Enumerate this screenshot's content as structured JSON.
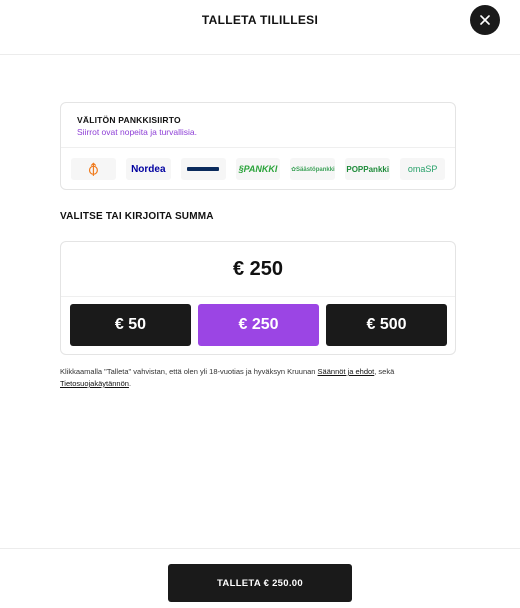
{
  "header": {
    "title": "TALLETA TILILLESI",
    "close_icon": "close-icon"
  },
  "bank_transfer": {
    "title": "VÄLITÖN PANKKISIIRTO",
    "subtitle": "Siirrot ovat nopeita ja turvallisia.",
    "banks": [
      {
        "name": "OP",
        "glyph": "⦽",
        "icon": "op-logo"
      },
      {
        "name": "Nordea",
        "icon": "nordea-logo"
      },
      {
        "name": "Danske Bank",
        "icon": "danske-bank-logo"
      },
      {
        "name": "S-PANKKI",
        "display": "PANKKI",
        "icon": "s-pankki-logo"
      },
      {
        "name": "Säästöpankki",
        "icon": "saastopankki-logo"
      },
      {
        "name": "POP Pankki",
        "display": "POPPankki",
        "icon": "pop-pankki-logo"
      },
      {
        "name": "OmaSP",
        "display": "omaSP",
        "icon": "omasp-logo"
      }
    ]
  },
  "amount": {
    "label": "VALITSE TAI KIRJOITA SUMMA",
    "value": "€ 250",
    "presets": [
      "€ 50",
      "€ 250",
      "€ 500"
    ],
    "selected_preset": "€ 250",
    "accent_color": "#9b45e4"
  },
  "terms": {
    "prefix": "Klikkaamalla \"Talleta\" vahvistan, että olen yli 18-vuotias ja hyväksyn Kruunan ",
    "rules_link": "Säännöt ja ehdot",
    "middle": ", sekä ",
    "privacy_link": "Tietosuojakäytännön",
    "suffix": "."
  },
  "footer": {
    "submit_label": "TALLETA € 250.00"
  }
}
